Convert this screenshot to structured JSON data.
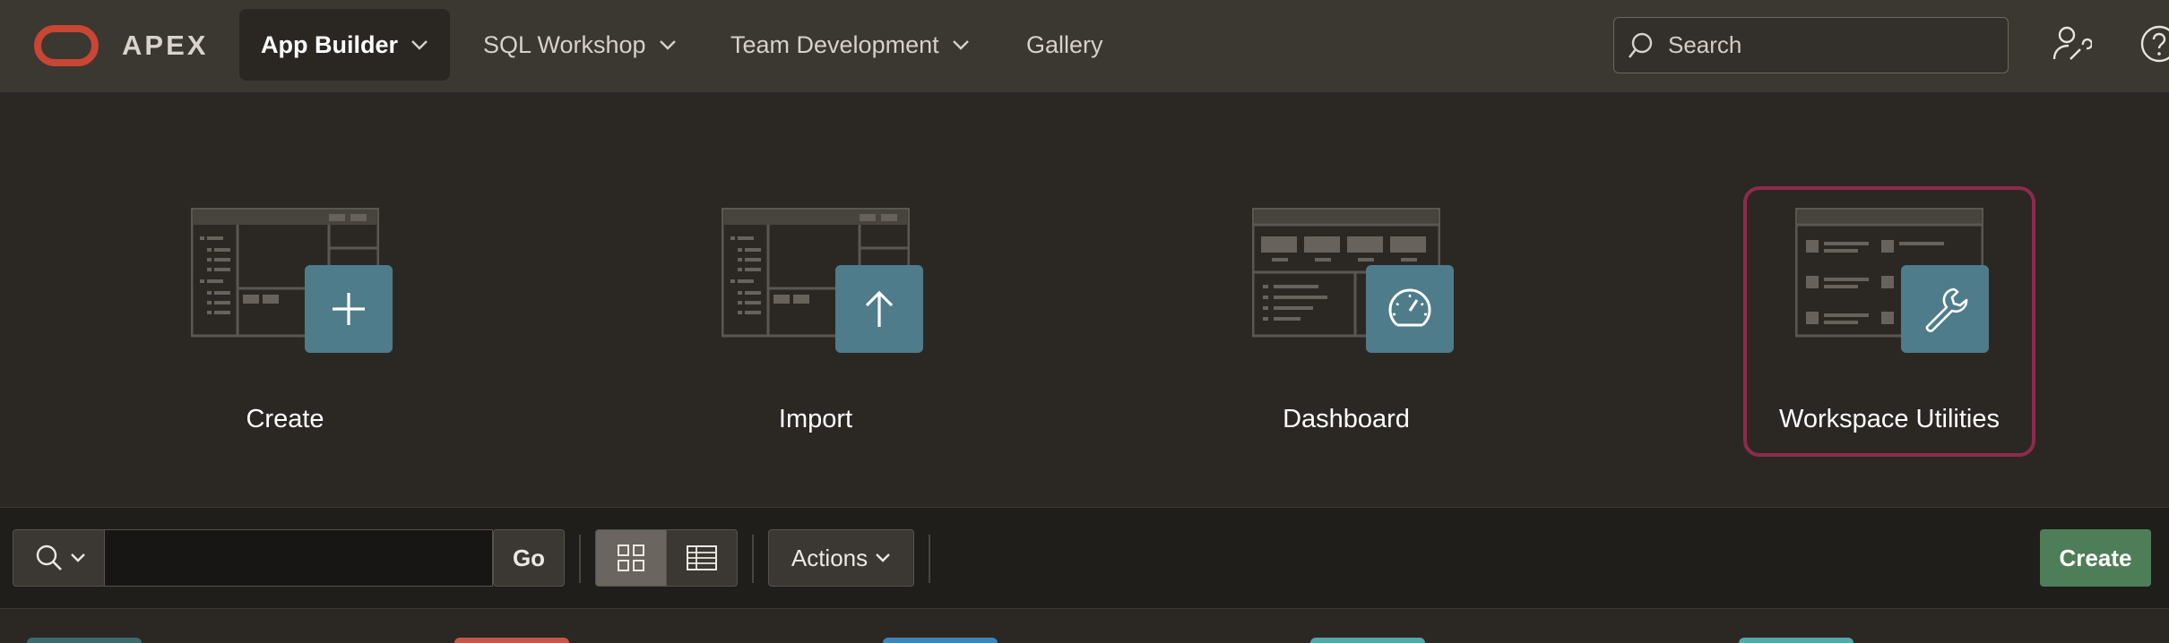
{
  "header": {
    "brand": "APEX",
    "nav": [
      {
        "label": "App Builder",
        "active": true
      },
      {
        "label": "SQL Workshop",
        "active": false
      },
      {
        "label": "Team Development",
        "active": false
      },
      {
        "label": "Gallery",
        "active": false
      }
    ],
    "search_placeholder": "Search",
    "icons": [
      "user-wrench-icon",
      "help-icon"
    ]
  },
  "tiles": [
    {
      "label": "Create",
      "icon": "plus-icon"
    },
    {
      "label": "Import",
      "icon": "arrow-up-icon"
    },
    {
      "label": "Dashboard",
      "icon": "gauge-icon"
    },
    {
      "label": "Workspace Utilities",
      "icon": "wrench-icon",
      "selected": true
    }
  ],
  "toolbar": {
    "search_value": "",
    "go_label": "Go",
    "actions_label": "Actions",
    "create_label": "Create",
    "view_modes": [
      "grid-view-icon",
      "report-view-icon"
    ],
    "active_view": "grid"
  },
  "colors": {
    "brand_red": "#c74634",
    "badge_teal": "#4e7c8a",
    "selected_border": "#8e2a4e",
    "create_green": "#4e7e58"
  }
}
